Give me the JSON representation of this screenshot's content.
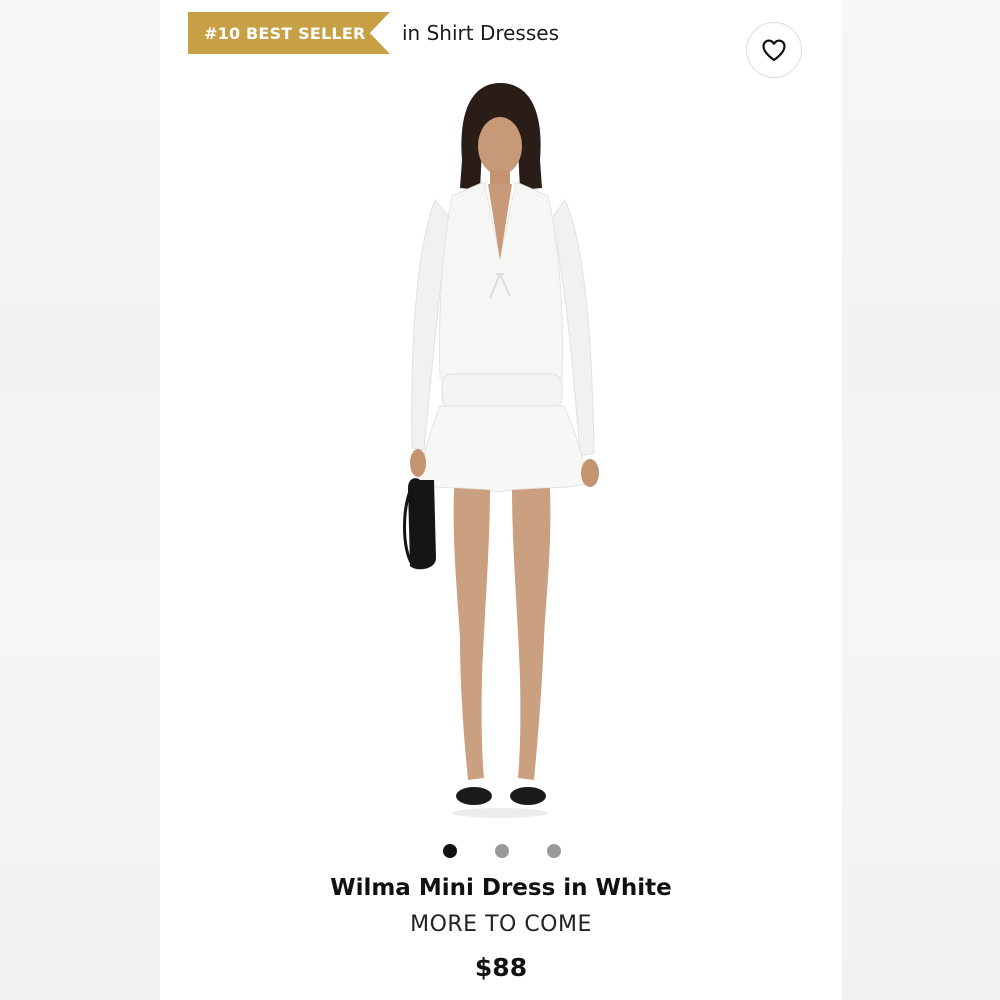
{
  "badge": {
    "label": "#10 BEST SELLER",
    "suffix": "in Shirt Dresses",
    "color": "#c7a045"
  },
  "wishlist": {
    "icon": "heart-outline-icon"
  },
  "product": {
    "image_alt": "Model wearing white long-sleeve tie-front mini dress with ruffled skirt, holding black bag, black thong sandals",
    "name": "Wilma Mini Dress in White",
    "brand": "MORE TO COME",
    "price": "$88"
  },
  "carousel": {
    "total": 3,
    "active_index": 0
  }
}
